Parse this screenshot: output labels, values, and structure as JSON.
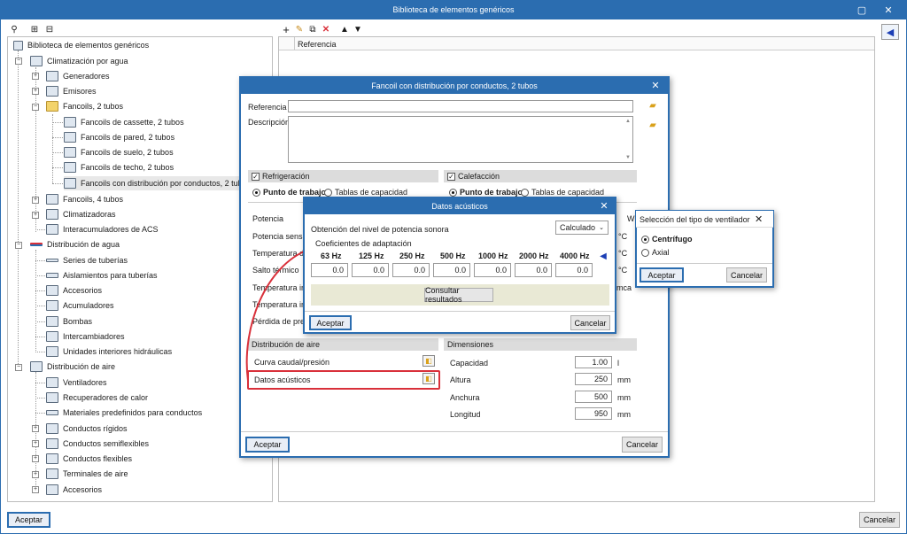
{
  "main": {
    "title": "Biblioteca de elementos genéricos",
    "accept_label": "Aceptar",
    "cancel_label": "Cancelar",
    "column_header": "Referencia"
  },
  "tree": {
    "root": "Biblioteca de elementos genéricos",
    "items": [
      {
        "label": "Climatización por agua"
      },
      {
        "label": "Generadores"
      },
      {
        "label": "Emisores"
      },
      {
        "label": "Fancoils, 2 tubos"
      },
      {
        "label": "Fancoils de cassette, 2 tubos"
      },
      {
        "label": "Fancoils de pared, 2 tubos"
      },
      {
        "label": "Fancoils de suelo, 2 tubos"
      },
      {
        "label": "Fancoils de techo, 2 tubos"
      },
      {
        "label": "Fancoils con distribución por conductos, 2 tubos"
      },
      {
        "label": "Fancoils, 4 tubos"
      },
      {
        "label": "Climatizadoras"
      },
      {
        "label": "Interacumuladores de ACS"
      },
      {
        "label": "Distribución de agua"
      },
      {
        "label": "Series de tuberías"
      },
      {
        "label": "Aislamientos para tuberías"
      },
      {
        "label": "Accesorios"
      },
      {
        "label": "Acumuladores"
      },
      {
        "label": "Bombas"
      },
      {
        "label": "Intercambiadores"
      },
      {
        "label": "Unidades interiores hidráulicas"
      },
      {
        "label": "Distribución de aire"
      },
      {
        "label": "Ventiladores"
      },
      {
        "label": "Recuperadores de calor"
      },
      {
        "label": "Materiales predefinidos para conductos"
      },
      {
        "label": "Conductos rígidos"
      },
      {
        "label": "Conductos semiflexibles"
      },
      {
        "label": "Conductos flexibles"
      },
      {
        "label": "Terminales de aire"
      },
      {
        "label": "Accesorios"
      }
    ]
  },
  "fancoil": {
    "title": "Fancoil con distribución por conductos, 2 tubos",
    "referencia_label": "Referencia",
    "descripcion_label": "Descripción",
    "refrigeracion_label": "Refrigeración",
    "calefaccion_label": "Calefacción",
    "punto_trabajo": "Punto de trabajo",
    "tablas_capacidad": "Tablas de capacidad",
    "rows": [
      "Potencia",
      "Potencia sensib",
      "Temperatura de",
      "Salto térmico",
      "Temperatura int",
      "Temperatura int",
      "Pérdida de pres"
    ],
    "right_frags": [
      "W",
      "°C",
      "°C",
      "°C",
      "mca"
    ],
    "distribucion_aire": "Distribución de aire",
    "curva_label": "Curva caudal/presión",
    "datos_acusticos_label": "Datos acústicos",
    "dimensiones": "Dimensiones",
    "dims": [
      {
        "label": "Capacidad",
        "value": "1.00",
        "unit": "l"
      },
      {
        "label": "Altura",
        "value": "250",
        "unit": "mm"
      },
      {
        "label": "Anchura",
        "value": "500",
        "unit": "mm"
      },
      {
        "label": "Longitud",
        "value": "950",
        "unit": "mm"
      }
    ],
    "accept": "Aceptar",
    "cancel": "Cancelar"
  },
  "acoustic": {
    "title": "Datos acústicos",
    "obtencion_label": "Obtención del nivel de potencia sonora",
    "select_value": "Calculado",
    "coef_label": "Coeficientes de adaptación",
    "freqs": [
      "63 Hz",
      "125 Hz",
      "250 Hz",
      "500 Hz",
      "1000 Hz",
      "2000 Hz",
      "4000 Hz"
    ],
    "values": [
      "0.0",
      "0.0",
      "0.0",
      "0.0",
      "0.0",
      "0.0",
      "0.0"
    ],
    "consultar": "Consultar resultados",
    "accept": "Aceptar",
    "cancel": "Cancelar"
  },
  "fan_type": {
    "title": "Selección del tipo de ventilador",
    "options": [
      "Centrífugo",
      "Axial"
    ],
    "accept": "Aceptar",
    "cancel": "Cancelar"
  },
  "colors": {
    "accent": "#2b6db0",
    "highlight": "#d9303a"
  }
}
